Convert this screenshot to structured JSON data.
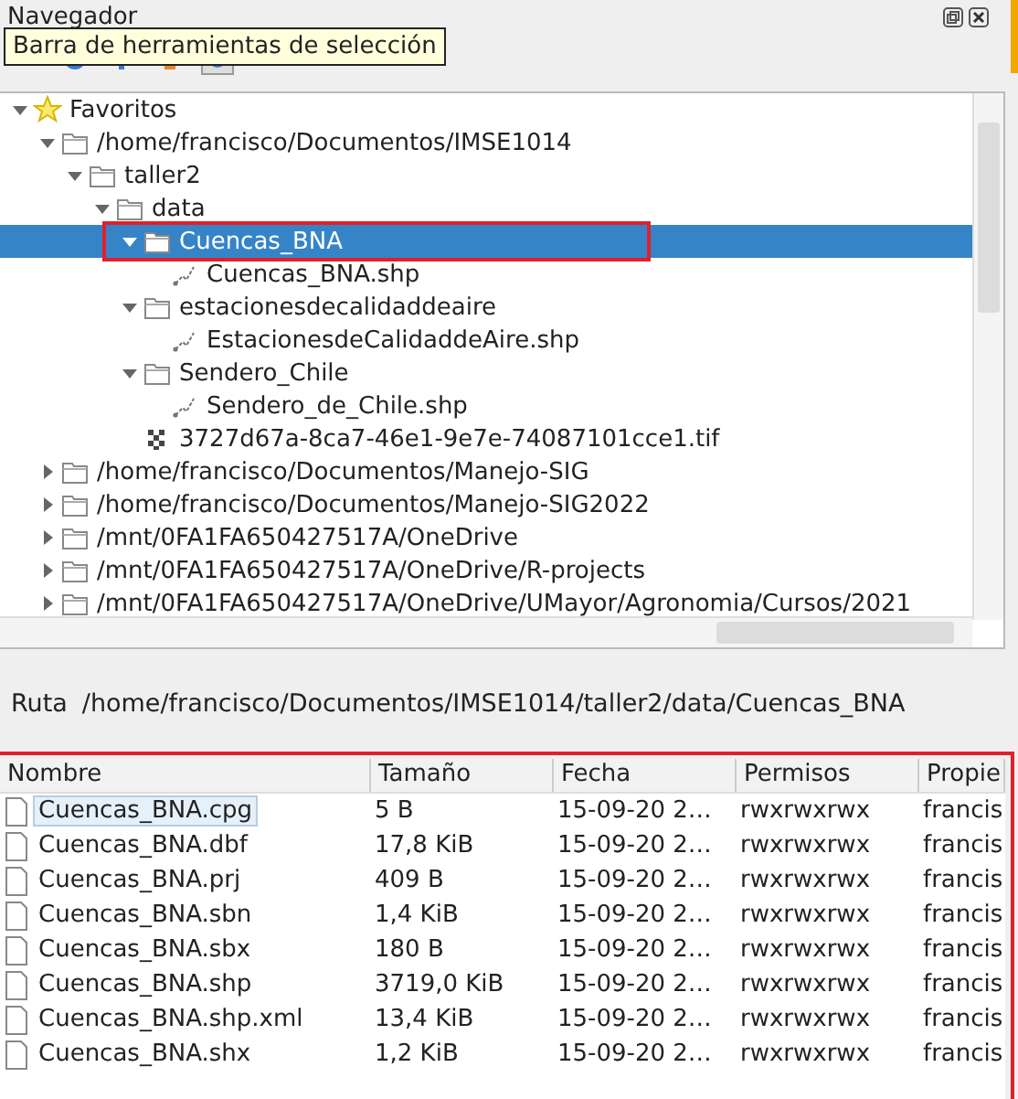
{
  "panel": {
    "title": "Navegador"
  },
  "tooltip": "Barra de herramientas de selección",
  "tree": [
    {
      "label": "Favoritos",
      "kind": "star",
      "expanded": true,
      "selected": false,
      "children": [
        {
          "label": "/home/francisco/Documentos/IMSE1014",
          "kind": "folder",
          "expanded": true,
          "selected": false,
          "children": [
            {
              "label": "taller2",
              "kind": "folder",
              "expanded": true,
              "selected": false,
              "children": [
                {
                  "label": "data",
                  "kind": "folder",
                  "expanded": true,
                  "selected": false,
                  "children": [
                    {
                      "label": "Cuencas_BNA",
                      "kind": "folder",
                      "expanded": true,
                      "selected": true,
                      "highlighted": true,
                      "children": [
                        {
                          "label": "Cuencas_BNA.shp",
                          "kind": "vector",
                          "selected": false
                        }
                      ]
                    },
                    {
                      "label": "estacionesdecalidaddeaire",
                      "kind": "folder",
                      "expanded": true,
                      "selected": false,
                      "children": [
                        {
                          "label": "EstacionesdeCalidaddeAire.shp",
                          "kind": "vector",
                          "selected": false
                        }
                      ]
                    },
                    {
                      "label": "Sendero_Chile",
                      "kind": "folder",
                      "expanded": true,
                      "selected": false,
                      "children": [
                        {
                          "label": "Sendero_de_Chile.shp",
                          "kind": "vector",
                          "selected": false
                        }
                      ]
                    },
                    {
                      "label": "3727d67a-8ca7-46e1-9e7e-74087101cce1.tif",
                      "kind": "raster",
                      "selected": false
                    }
                  ]
                }
              ]
            }
          ]
        },
        {
          "label": "/home/francisco/Documentos/Manejo-SIG",
          "kind": "folder",
          "expanded": false,
          "selected": false
        },
        {
          "label": "/home/francisco/Documentos/Manejo-SIG2022",
          "kind": "folder",
          "expanded": false,
          "selected": false
        },
        {
          "label": "/mnt/0FA1FA650427517A/OneDrive",
          "kind": "folder",
          "expanded": false,
          "selected": false
        },
        {
          "label": "/mnt/0FA1FA650427517A/OneDrive/R-projects",
          "kind": "folder",
          "expanded": false,
          "selected": false
        },
        {
          "label": "/mnt/0FA1FA650427517A/OneDrive/UMayor/Agronomia/Cursos/2021",
          "kind": "folder",
          "expanded": false,
          "selected": false
        }
      ]
    }
  ],
  "path": {
    "label": "Ruta",
    "value": "/home/francisco/Documentos/IMSE1014/taller2/data/Cuencas_BNA"
  },
  "files": {
    "highlighted": true,
    "columns": [
      "Nombre",
      "Tamaño",
      "Fecha",
      "Permisos",
      "Propie"
    ],
    "rows": [
      {
        "name": "Cuencas_BNA.cpg",
        "size": "5 B",
        "date": "15-09-20 2…",
        "perms": "rwxrwxrwx",
        "owner": "francis",
        "selected": true
      },
      {
        "name": "Cuencas_BNA.dbf",
        "size": "17,8 KiB",
        "date": "15-09-20 2…",
        "perms": "rwxrwxrwx",
        "owner": "francis",
        "selected": false
      },
      {
        "name": "Cuencas_BNA.prj",
        "size": "409 B",
        "date": "15-09-20 2…",
        "perms": "rwxrwxrwx",
        "owner": "francis",
        "selected": false
      },
      {
        "name": "Cuencas_BNA.sbn",
        "size": "1,4 KiB",
        "date": "15-09-20 2…",
        "perms": "rwxrwxrwx",
        "owner": "francis",
        "selected": false
      },
      {
        "name": "Cuencas_BNA.sbx",
        "size": "180 B",
        "date": "15-09-20 2…",
        "perms": "rwxrwxrwx",
        "owner": "francis",
        "selected": false
      },
      {
        "name": "Cuencas_BNA.shp",
        "size": "3719,0 KiB",
        "date": "15-09-20 2…",
        "perms": "rwxrwxrwx",
        "owner": "francis",
        "selected": false
      },
      {
        "name": "Cuencas_BNA.shp.xml",
        "size": "13,4 KiB",
        "date": "15-09-20 2…",
        "perms": "rwxrwxrwx",
        "owner": "francis",
        "selected": false
      },
      {
        "name": "Cuencas_BNA.shx",
        "size": "1,2 KiB",
        "date": "15-09-20 2…",
        "perms": "rwxrwxrwx",
        "owner": "francis",
        "selected": false
      }
    ]
  }
}
